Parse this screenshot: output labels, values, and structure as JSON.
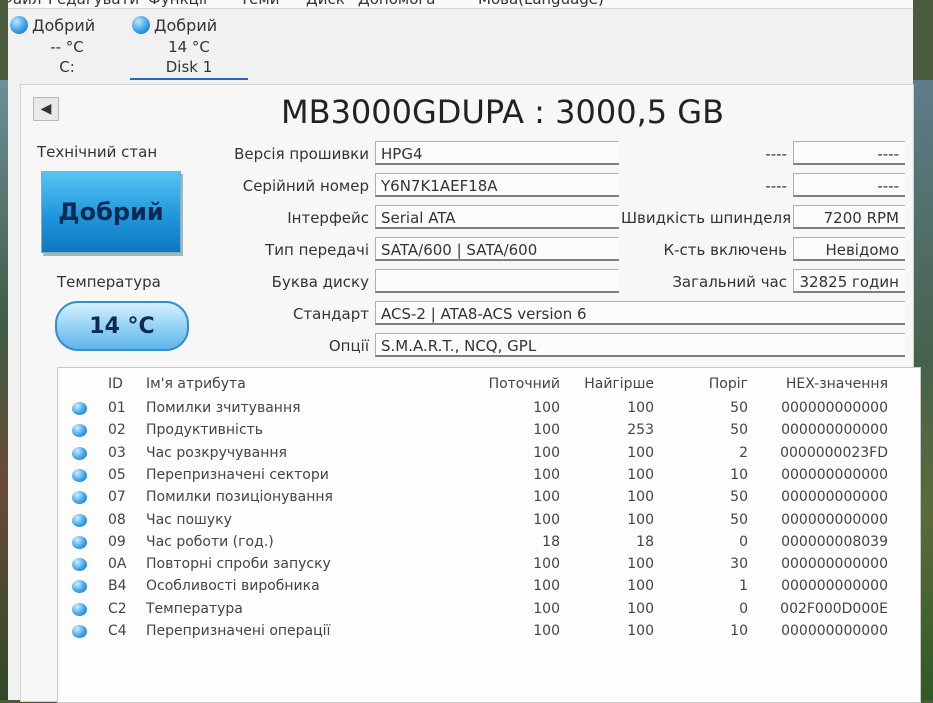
{
  "menu": {
    "items": [
      "Файл",
      "Редагувати",
      "Функції",
      "Теми",
      "Диск",
      "Допомога",
      "Мова(Language)"
    ]
  },
  "disks": [
    {
      "status": "Добрий",
      "temp": "-- °C",
      "name": "C:"
    },
    {
      "status": "Добрий",
      "temp": "14 °C",
      "name": "Disk 1"
    }
  ],
  "drive": {
    "title": "MB3000GDUPA : 3000,5 GB",
    "health_label": "Технічний стан",
    "health_value": "Добрий",
    "temp_label": "Температура",
    "temp_value": "14 °C"
  },
  "info": {
    "firmware_label": "Версія прошивки",
    "firmware": "HPG4",
    "serial_label": "Серійний номер",
    "serial": "Y6N7K1AEF18A",
    "interface_label": "Інтерфейс",
    "interface": "Serial ATA",
    "transfer_label": "Тип передачі",
    "transfer": "SATA/600 | SATA/600",
    "letter_label": "Буква диску",
    "letter": "",
    "standard_label": "Стандарт",
    "standard": "ACS-2 | ATA8-ACS version 6",
    "options_label": "Опції",
    "options": "S.M.A.R.T., NCQ, GPL",
    "blank1_label": "----",
    "blank1": "----",
    "blank2_label": "----",
    "blank2": "----",
    "rpm_label": "Швидкість шпинделя",
    "rpm": "7200 RPM",
    "power_count_label": "К-сть включень",
    "power_count": "Невідомо",
    "hours_label": "Загальний час",
    "hours": "32825 годин"
  },
  "smart": {
    "headers": {
      "id": "ID",
      "name": "Ім'я атрибута",
      "current": "Поточний",
      "worst": "Найгірше",
      "threshold": "Поріг",
      "hex": "HEX-значення"
    },
    "rows": [
      {
        "id": "01",
        "name": "Помилки зчитування",
        "current": "100",
        "worst": "100",
        "threshold": "50",
        "hex": "000000000000"
      },
      {
        "id": "02",
        "name": "Продуктивність",
        "current": "100",
        "worst": "253",
        "threshold": "50",
        "hex": "000000000000"
      },
      {
        "id": "03",
        "name": "Час розкручування",
        "current": "100",
        "worst": "100",
        "threshold": "2",
        "hex": "0000000023FD"
      },
      {
        "id": "05",
        "name": "Перепризначені сектори",
        "current": "100",
        "worst": "100",
        "threshold": "10",
        "hex": "000000000000"
      },
      {
        "id": "07",
        "name": "Помилки позиціонування",
        "current": "100",
        "worst": "100",
        "threshold": "50",
        "hex": "000000000000"
      },
      {
        "id": "08",
        "name": "Час пошуку",
        "current": "100",
        "worst": "100",
        "threshold": "50",
        "hex": "000000000000"
      },
      {
        "id": "09",
        "name": "Час роботи (год.)",
        "current": "18",
        "worst": "18",
        "threshold": "0",
        "hex": "000000008039"
      },
      {
        "id": "0A",
        "name": "Повторні спроби запуску",
        "current": "100",
        "worst": "100",
        "threshold": "30",
        "hex": "000000000000"
      },
      {
        "id": "B4",
        "name": "Особливості виробника",
        "current": "100",
        "worst": "100",
        "threshold": "1",
        "hex": "000000000000"
      },
      {
        "id": "C2",
        "name": "Температура",
        "current": "100",
        "worst": "100",
        "threshold": "0",
        "hex": "002F000D000E"
      },
      {
        "id": "C4",
        "name": "Перепризначені операції",
        "current": "100",
        "worst": "100",
        "threshold": "10",
        "hex": "000000000000"
      }
    ]
  }
}
